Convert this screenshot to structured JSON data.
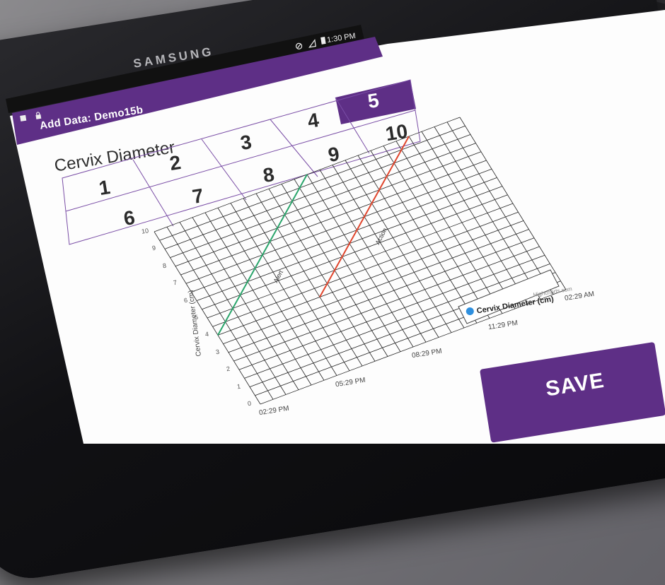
{
  "device": {
    "brand": "SAMSUNG"
  },
  "status_bar": {
    "time": "1:30 PM"
  },
  "app_bar": {
    "title": "Add Data: Demo15b"
  },
  "page": {
    "title": "Cervix Diameter"
  },
  "number_grid": {
    "cells": [
      "1",
      "2",
      "3",
      "4",
      "5",
      "6",
      "7",
      "8",
      "9",
      "10"
    ],
    "selected": "5"
  },
  "chart_data": {
    "type": "line",
    "ylabel": "Cervix Diameter (cm)",
    "yticks": [
      "0",
      "1",
      "2",
      "3",
      "4",
      "5",
      "6",
      "7",
      "8",
      "9",
      "10"
    ],
    "xticks": [
      "02:29 PM",
      "05:29 PM",
      "08:29 PM",
      "11:29 PM",
      "02:29 AM"
    ],
    "ylim": [
      0,
      10
    ],
    "series": [
      {
        "name": "Alert",
        "color": "#2aa56b",
        "x": [
          "02:29 PM",
          "08:29 PM"
        ],
        "y": [
          4,
          10
        ]
      },
      {
        "name": "Action",
        "color": "#e0452c",
        "x": [
          "06:29 PM",
          "12:29 AM"
        ],
        "y": [
          4,
          10
        ]
      }
    ],
    "legend": {
      "label": "Cervix Diameter (cm)",
      "color": "#2e8fde",
      "position": "right"
    },
    "credits": "Highcharts.com",
    "grid": true
  },
  "actions": {
    "save_label": "SAVE"
  },
  "colors": {
    "accent": "#5e2f86",
    "alert_line": "#2aa56b",
    "action_line": "#e0452c"
  }
}
